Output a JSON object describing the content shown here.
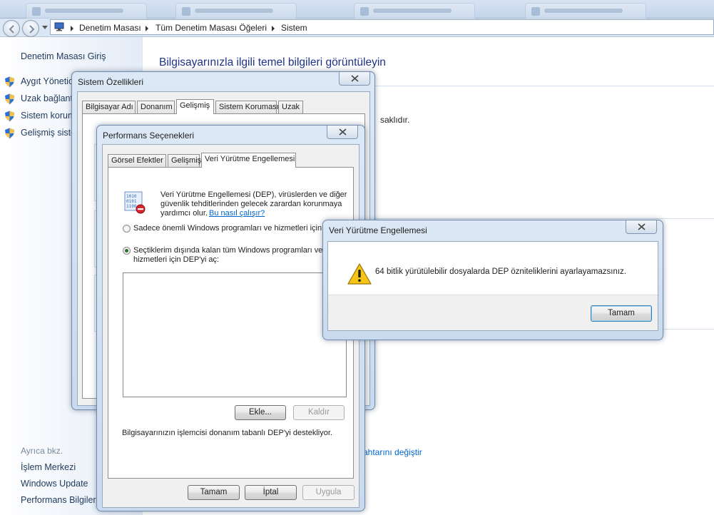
{
  "breadcrumbs": [
    "Denetim Masası",
    "Tüm Denetim Masası Öğeleri",
    "Sistem"
  ],
  "left_pane": {
    "home_link": "Denetim Masası Giriş",
    "tasks": [
      "Aygıt Yönetici",
      "Uzak bağlantı",
      "Sistem korum",
      "Gelişmiş siste"
    ],
    "see_also_title": "Ayrıca bkz.",
    "see_also": [
      "İşlem Merkezi",
      "Windows Update",
      "Performans Bilgileri"
    ]
  },
  "main": {
    "title": "Bilgisayarınızla ilgili temel bilgileri görüntüleyin",
    "fragment_rights": "saklıdır.",
    "fragment_link": "ahtarını değiştir"
  },
  "sys_props": {
    "title": "Sistem Özellikleri",
    "tabs": [
      "Bilgisayar Adı",
      "Donanım",
      "Gelişmiş",
      "Sistem Koruması",
      "Uzak"
    ],
    "active_tab": "Gelişmiş"
  },
  "perf_opts": {
    "title": "Performans Seçenekleri",
    "tabs": [
      "Görsel Efektler",
      "Gelişmiş",
      "Veri Yürütme Engellemesi"
    ],
    "active_tab": "Veri Yürütme Engellemesi",
    "description_lines": [
      "Veri Yürütme Engellemesi (DEP), virüslerden ve diğer",
      "güvenlik tehditlerinden gelecek zarardan korunmaya",
      "yardımcı olur."
    ],
    "help_link": "Bu nasıl çalışır?",
    "option1": "Sadece önemli Windows programları ve hizmetleri için DEP",
    "option2_lines": [
      "Seçtiklerim dışında kalan tüm Windows programları ve",
      "hizmetleri için DEP'yi aç:"
    ],
    "selected_option": 2,
    "add_button": "Ekle...",
    "remove_button": "Kaldır",
    "support_text": "Bilgisayarınızın işlemcisi donanım tabanlı DEP'yi destekliyor.",
    "ok_button": "Tamam",
    "cancel_button": "İptal",
    "apply_button": "Uygula"
  },
  "message_box": {
    "title": "Veri Yürütme Engellemesi",
    "message": "64 bitlik yürütülebilir dosyalarda DEP özniteliklerini ayarlayamazsınız.",
    "ok_button": "Tamam"
  },
  "colors": {
    "link": "#0066cc",
    "title": "#1e3287",
    "warning": "#f5c518"
  }
}
